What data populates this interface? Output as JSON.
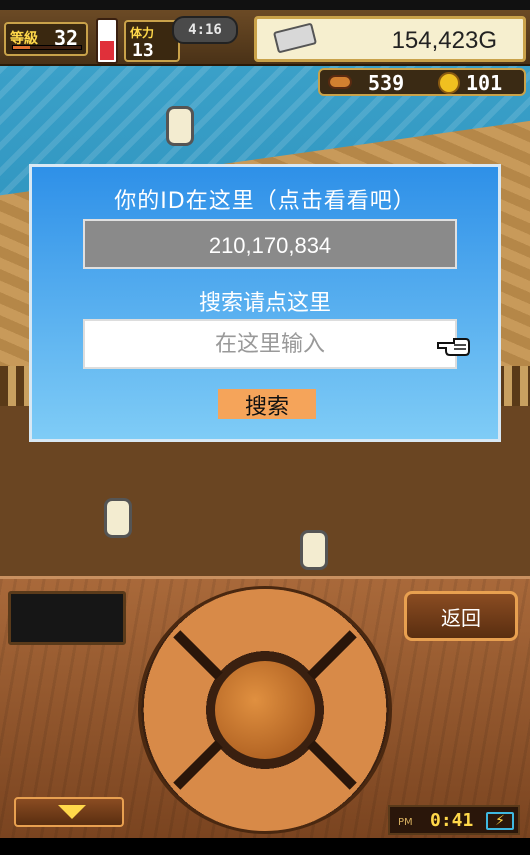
{
  "hud": {
    "level_label": "等級",
    "level_value": "32",
    "level_progress": 0.25,
    "stamina_label": "体力",
    "stamina_value": "13",
    "stamina_fill": 0.55,
    "clock": "4:16",
    "gold": "154,423G",
    "resource_meat": "539",
    "resource_coins": "101"
  },
  "dialog": {
    "title": "你的ID在这里（点击看看吧）",
    "id_value": "210,170,834",
    "search_label": "搜索请点这里",
    "input_placeholder": "在这里输入",
    "input_value": "",
    "search_button": "搜索"
  },
  "panel": {
    "back_button": "返回",
    "time_ampm": "PM",
    "time_value": "0:41",
    "battery_symbol": "⚡"
  },
  "colors": {
    "dialog_top": "#2e90e8",
    "dialog_bottom": "#7fccf6",
    "search_button": "#f5a45a",
    "id_box": "#8a8a8a"
  }
}
